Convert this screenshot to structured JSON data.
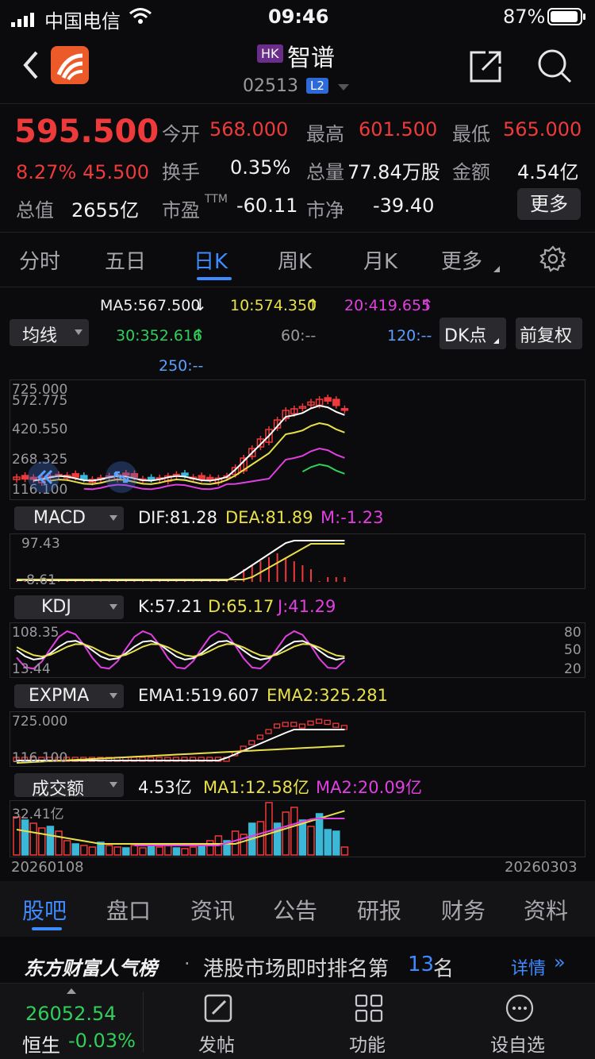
{
  "status_bar": {
    "carrier": "中国电信",
    "time": "09:46",
    "battery": "87%"
  },
  "header": {
    "exchange_badge": "HK",
    "name": "智谱",
    "code": "02513",
    "level_badge": "L2"
  },
  "quote": {
    "price": "595.500",
    "change_pct": "8.27%",
    "change_abs": "45.500",
    "open_label": "今开",
    "open": "568.000",
    "high_label": "最高",
    "high": "601.500",
    "low_label": "最低",
    "low": "565.000",
    "turnover_label": "换手",
    "turnover": "0.35%",
    "volume_label": "总量",
    "volume": "77.84万股",
    "amount_label": "金额",
    "amount": "4.54亿",
    "mktcap_label": "总值",
    "mktcap": "2655亿",
    "pe_label": "市盈",
    "pe_sup": "TTM",
    "pe": "-60.11",
    "pb_label": "市净",
    "pb": "-39.40",
    "more": "更多"
  },
  "period_tabs": [
    "分时",
    "五日",
    "日K",
    "周K",
    "月K",
    "更多"
  ],
  "ma_panel": {
    "selector": "均线",
    "ma5": "MA5:567.500",
    "ma10": "10:574.350",
    "ma20": "20:419.655",
    "ma30": "30:352.616",
    "ma60": "60:--",
    "ma120": "120:--",
    "ma250": "250:--",
    "dk_button": "DK点",
    "adjust_button": "前复权"
  },
  "main_chart": {
    "ticks": [
      "725.000",
      "572.775",
      "420.550",
      "268.325",
      "116.100"
    ]
  },
  "macd": {
    "selector": "MACD",
    "dif": "DIF:81.28",
    "dea": "DEA:81.89",
    "m": "M:-1.23",
    "top": "97.43",
    "bottom": "-8.61"
  },
  "kdj": {
    "selector": "KDJ",
    "k": "K:57.21",
    "d": "D:65.17",
    "j": "J:41.29",
    "top": "108.35",
    "bottom": "13.44",
    "levels": [
      "80",
      "50",
      "20"
    ]
  },
  "expma": {
    "selector": "EXPMA",
    "ema1": "EMA1:519.607",
    "ema2": "EMA2:325.281",
    "top": "725.000",
    "bottom": "116.100"
  },
  "volume": {
    "selector": "成交额",
    "current": "4.53亿",
    "ma1": "MA1:12.58亿",
    "ma2": "MA2:20.09亿",
    "top": "32.41亿"
  },
  "date_range": {
    "start": "20260108",
    "end": "20260303"
  },
  "info_tabs": [
    "股吧",
    "盘口",
    "资讯",
    "公告",
    "研报",
    "财务",
    "资料"
  ],
  "ranking": {
    "brand": "东方财富人气榜",
    "text_prefix": "港股市场即时排名第",
    "rank": "13",
    "text_suffix": "名",
    "detail": "详情"
  },
  "bottom_bar": {
    "index_value": "26052.54",
    "index_name": "恒生",
    "index_change": "-0.03%",
    "post": "发帖",
    "functions": "功能",
    "watchlist": "设自选"
  },
  "colors": {
    "up": "#ee3a3a",
    "down": "#2fcf5a",
    "accent": "#3d8bff",
    "ma5": "#ffffff",
    "ma10": "#e8e04a",
    "ma20": "#e040e0",
    "ma30": "#2fcf5a",
    "ma120": "#5aa0ff",
    "bg": "#0b0b0d"
  }
}
